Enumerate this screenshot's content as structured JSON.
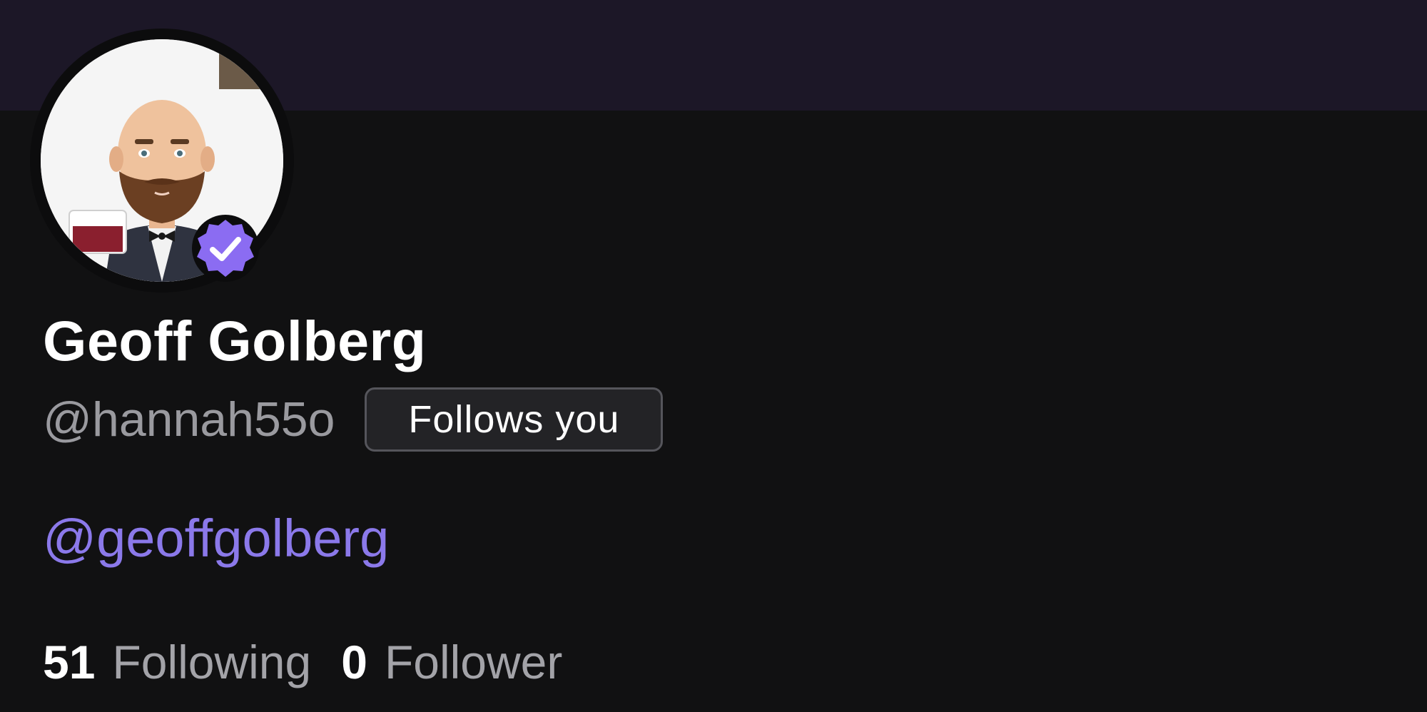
{
  "profile": {
    "display_name": "Geoff Golberg",
    "handle": "@hannah55o",
    "follows_you_label": "Follows you",
    "bio_mention": "@geoffgolberg",
    "avatar_icon": "bitmoji-avatar",
    "verified_icon": "verified-badge-icon",
    "verified_color": "#8b6cf2"
  },
  "stats": {
    "following_count": "51",
    "following_label": "Following",
    "follower_count": "0",
    "follower_label": "Follower"
  },
  "colors": {
    "banner": "#1c1727",
    "background": "#111112",
    "accent_link": "#8b79ea",
    "muted_text": "#9a9a9f"
  }
}
